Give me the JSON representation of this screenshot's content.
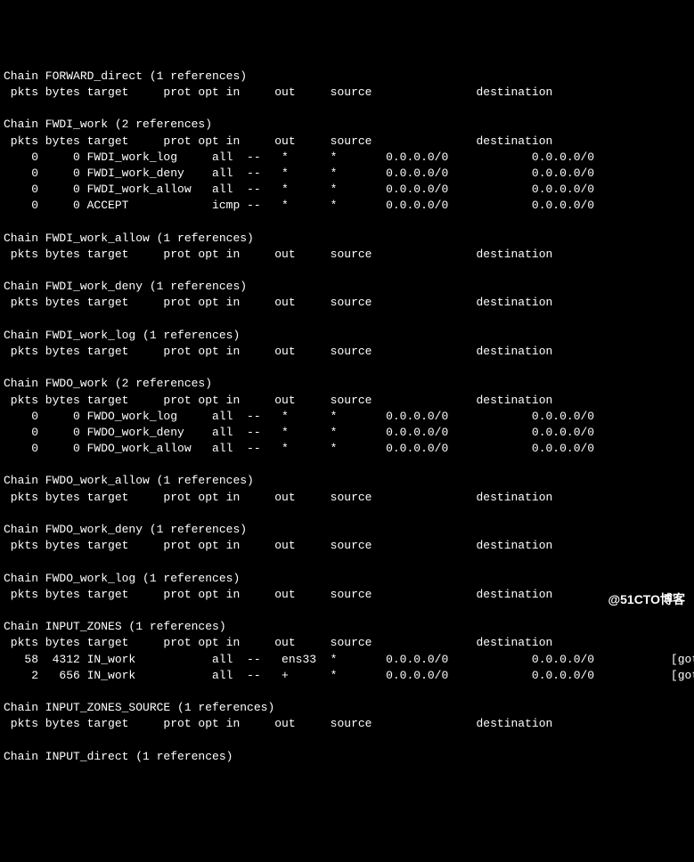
{
  "hdrcols": "pkts bytes target     prot opt in     out     source               destination",
  "chains": [
    {
      "name": "FORWARD_direct",
      "refs": "1 references",
      "rules": []
    },
    {
      "name": "FWDI_work",
      "refs": "2 references",
      "rules": [
        {
          "pkts": "0",
          "bytes": "0",
          "target": "FWDI_work_log",
          "prot": "all",
          "opt": "--",
          "in": "*",
          "out": "*",
          "src": "0.0.0.0/0",
          "dst": "0.0.0.0/0",
          "extra": ""
        },
        {
          "pkts": "0",
          "bytes": "0",
          "target": "FWDI_work_deny",
          "prot": "all",
          "opt": "--",
          "in": "*",
          "out": "*",
          "src": "0.0.0.0/0",
          "dst": "0.0.0.0/0",
          "extra": ""
        },
        {
          "pkts": "0",
          "bytes": "0",
          "target": "FWDI_work_allow",
          "prot": "all",
          "opt": "--",
          "in": "*",
          "out": "*",
          "src": "0.0.0.0/0",
          "dst": "0.0.0.0/0",
          "extra": ""
        },
        {
          "pkts": "0",
          "bytes": "0",
          "target": "ACCEPT",
          "prot": "icmp",
          "opt": "--",
          "in": "*",
          "out": "*",
          "src": "0.0.0.0/0",
          "dst": "0.0.0.0/0",
          "extra": ""
        }
      ]
    },
    {
      "name": "FWDI_work_allow",
      "refs": "1 references",
      "rules": []
    },
    {
      "name": "FWDI_work_deny",
      "refs": "1 references",
      "rules": []
    },
    {
      "name": "FWDI_work_log",
      "refs": "1 references",
      "rules": []
    },
    {
      "name": "FWDO_work",
      "refs": "2 references",
      "rules": [
        {
          "pkts": "0",
          "bytes": "0",
          "target": "FWDO_work_log",
          "prot": "all",
          "opt": "--",
          "in": "*",
          "out": "*",
          "src": "0.0.0.0/0",
          "dst": "0.0.0.0/0",
          "extra": ""
        },
        {
          "pkts": "0",
          "bytes": "0",
          "target": "FWDO_work_deny",
          "prot": "all",
          "opt": "--",
          "in": "*",
          "out": "*",
          "src": "0.0.0.0/0",
          "dst": "0.0.0.0/0",
          "extra": ""
        },
        {
          "pkts": "0",
          "bytes": "0",
          "target": "FWDO_work_allow",
          "prot": "all",
          "opt": "--",
          "in": "*",
          "out": "*",
          "src": "0.0.0.0/0",
          "dst": "0.0.0.0/0",
          "extra": ""
        }
      ]
    },
    {
      "name": "FWDO_work_allow",
      "refs": "1 references",
      "rules": []
    },
    {
      "name": "FWDO_work_deny",
      "refs": "1 references",
      "rules": []
    },
    {
      "name": "FWDO_work_log",
      "refs": "1 references",
      "rules": []
    },
    {
      "name": "INPUT_ZONES",
      "refs": "1 references",
      "rules": [
        {
          "pkts": "58",
          "bytes": "4312",
          "target": "IN_work",
          "prot": "all",
          "opt": "--",
          "in": "ens33",
          "out": "*",
          "src": "0.0.0.0/0",
          "dst": "0.0.0.0/0",
          "extra": "[goto]"
        },
        {
          "pkts": "2",
          "bytes": "656",
          "target": "IN_work",
          "prot": "all",
          "opt": "--",
          "in": "+",
          "out": "*",
          "src": "0.0.0.0/0",
          "dst": "0.0.0.0/0",
          "extra": "[goto]"
        }
      ]
    },
    {
      "name": "INPUT_ZONES_SOURCE",
      "refs": "1 references",
      "rules": []
    },
    {
      "name": "INPUT_direct",
      "refs": "1 references",
      "rules": null
    }
  ],
  "watermark": "@51CTO博客"
}
